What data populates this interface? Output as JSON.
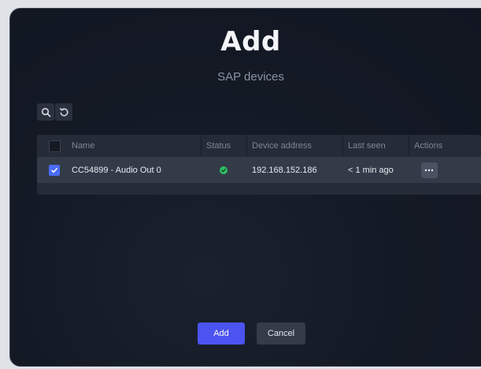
{
  "dialog": {
    "title": "Add",
    "subtitle": "SAP devices"
  },
  "toolbar": {
    "search_icon": "search-icon",
    "refresh_icon": "refresh-icon"
  },
  "table": {
    "headers": {
      "name": "Name",
      "status": "Status",
      "address": "Device address",
      "last_seen": "Last seen",
      "actions": "Actions"
    },
    "rows": [
      {
        "checked": true,
        "name": "CC54899 - Audio Out 0",
        "status": "online",
        "address": "192.168.152.186",
        "last_seen": "< 1 min ago",
        "actions_icon": "more-icon"
      }
    ]
  },
  "buttons": {
    "add": "Add",
    "cancel": "Cancel"
  },
  "colors": {
    "accent": "#4b53f0",
    "checkbox": "#4b6cf6",
    "status_ok": "#2fbe63",
    "background": "#141a25"
  }
}
